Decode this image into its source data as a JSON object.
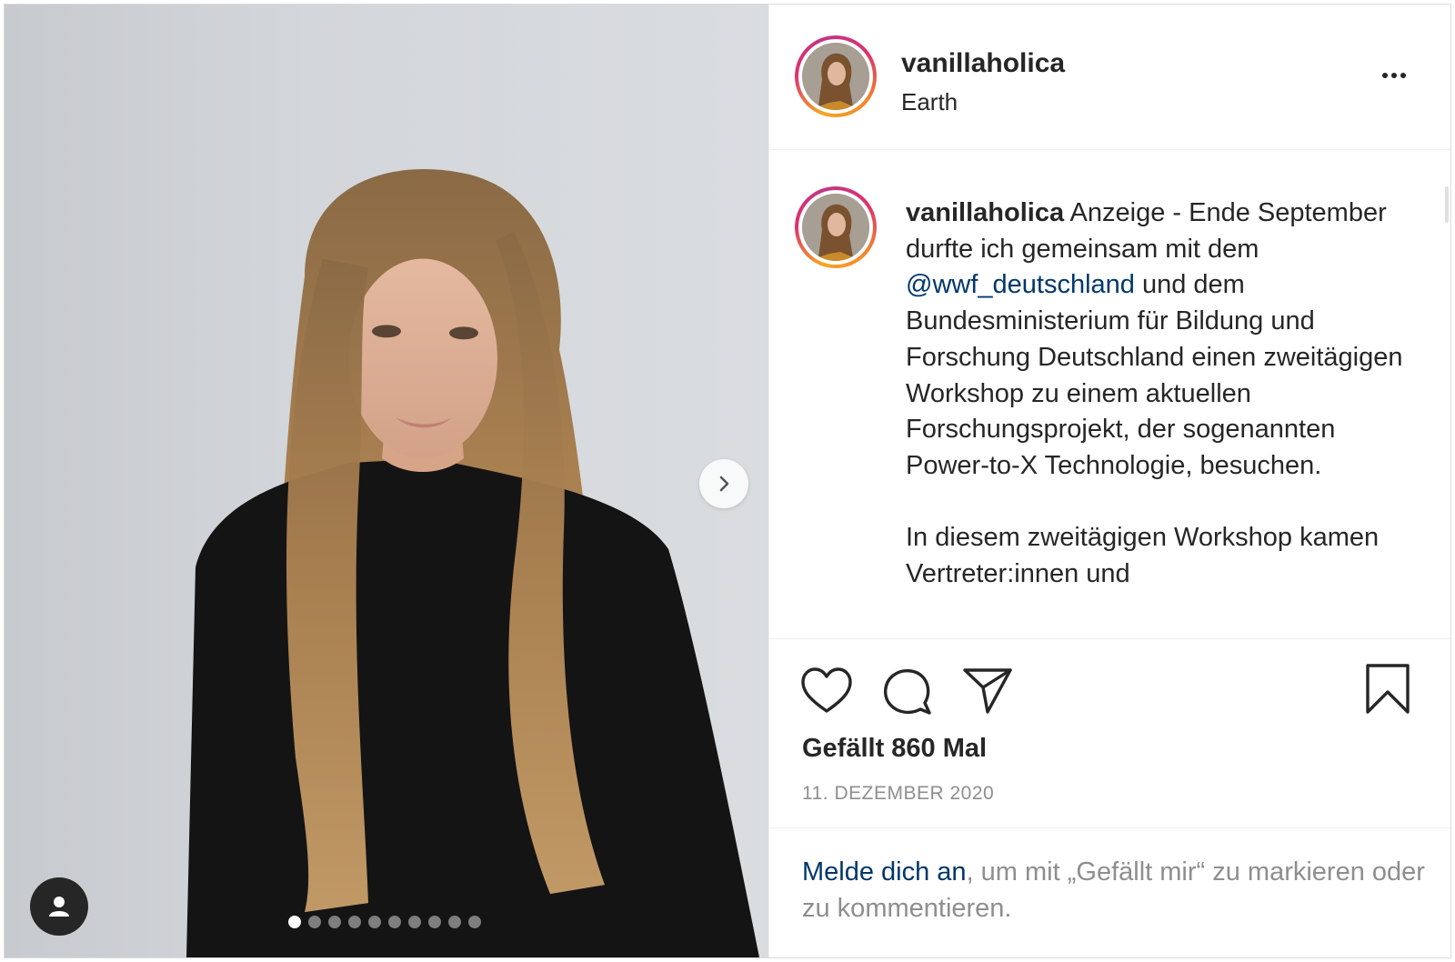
{
  "post": {
    "username": "vanillaholica",
    "location": "Earth",
    "caption": {
      "username": "vanillaholica",
      "text_before_mention": " Anzeige - Ende September durfte ich gemeinsam mit dem ",
      "mention": "@wwf_deutschland",
      "text_after_mention": " und dem Bundesministerium für Bildung und Forschung Deutschland einen zweitägigen Workshop zu einem aktuellen Forschungsprojekt, der sogenannten Power-to-X Technologie, besuchen.\n\nIn diesem zweitägigen Workshop kamen Vertreter:innen und"
    },
    "likes_label": "Gefällt 860 Mal",
    "date": "11. DEZEMBER 2020",
    "login_prompt": {
      "link": "Melde dich an",
      "text": ", um mit „Gefällt mir“ zu markieren oder zu kommentieren."
    }
  },
  "carousel": {
    "slide_count": 10,
    "active_index": 0
  },
  "icons": {
    "heart": "heart-icon",
    "comment": "comment-icon",
    "share": "share-icon",
    "save": "bookmark-icon",
    "more": "more-options-icon",
    "next": "chevron-right-icon",
    "tagged_users": "user-icon"
  },
  "colors": {
    "link": "#00376b",
    "secondary_text": "#8e8e8e",
    "primary_text": "#262626"
  }
}
